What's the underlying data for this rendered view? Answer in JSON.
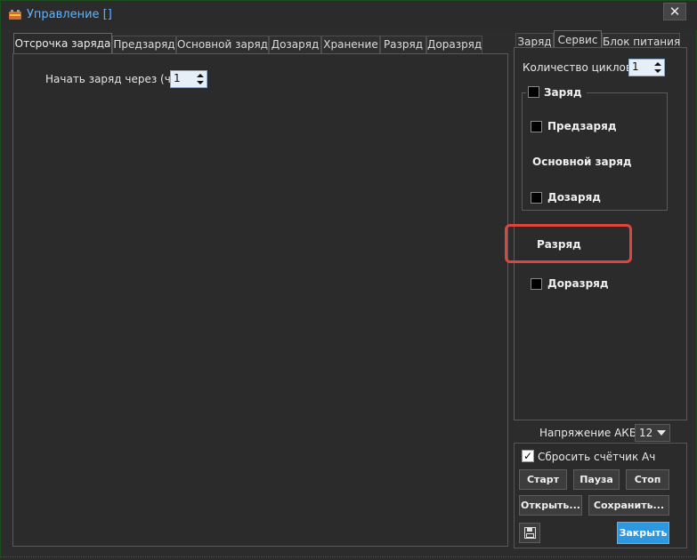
{
  "window": {
    "title": "Управление []",
    "close_label": "✕"
  },
  "left_tabs": [
    {
      "label": "Отсрочка заряда"
    },
    {
      "label": "Предзаряд"
    },
    {
      "label": "Основной заряд"
    },
    {
      "label": "Дозаряд"
    },
    {
      "label": "Хранение"
    },
    {
      "label": "Разряд"
    },
    {
      "label": "Доразряд"
    }
  ],
  "delay": {
    "label": "Начать заряд через (ч):",
    "value": "1"
  },
  "right_tabs": [
    {
      "label": "Заряд"
    },
    {
      "label": "Сервис"
    },
    {
      "label": "Блок питания"
    }
  ],
  "service": {
    "cycles_label": "Количество циклов:",
    "cycles_value": "1",
    "charge_label": "Заряд",
    "precharge_label": "Предзаряд",
    "main_charge_label": "Основной заряд",
    "topup_label": "Дозаряд",
    "discharge_label": "Разряд",
    "extra_discharge_label": "Доразряд"
  },
  "voltage": {
    "label": "Напряжение АКБ:",
    "value": "12"
  },
  "controls": {
    "reset_label": "Сбросить счётчик Ач",
    "start_label": "Старт",
    "pause_label": "Пауза",
    "stop_label": "Стоп",
    "open_label": "Открыть...",
    "save_label": "Сохранить...",
    "close_label": "Закрыть"
  },
  "colors": {
    "accent": "#2f97df",
    "title": "#5fb3ff",
    "highlight": "#e0453d"
  }
}
